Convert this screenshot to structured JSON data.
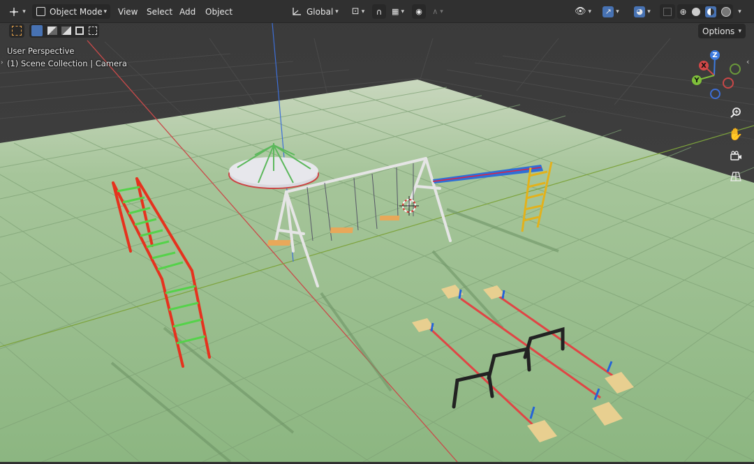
{
  "header": {
    "editor_type_icon": "viewport-icon",
    "mode_label": "Object Mode",
    "menus": [
      "View",
      "Select",
      "Add",
      "Object"
    ],
    "transform_orientation": "Global",
    "options_label": "Options"
  },
  "viewport": {
    "perspective_label": "User Perspective",
    "collection_label": "(1) Scene Collection | Camera",
    "gizmo": {
      "z": "Z",
      "x": "X",
      "y": "Y"
    }
  },
  "colors": {
    "ui_background": "#303030",
    "accent_blue": "#4772b3",
    "ground": "#8fb685",
    "axis_red": "#c94a4a",
    "axis_green": "#7da33c",
    "axis_blue": "#3d6fd8"
  }
}
